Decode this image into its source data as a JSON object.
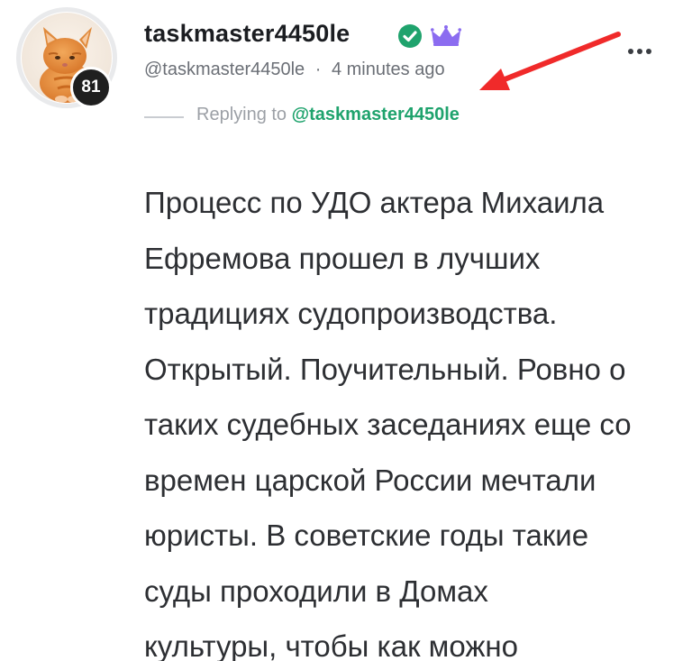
{
  "author": {
    "display_name": "taskmaster4450le",
    "handle": "@taskmaster4450le",
    "reputation": "81",
    "avatar_icon": "orange-kitten-avatar",
    "verified_icon": "verified-check-icon",
    "verified_color": "#1fa36d",
    "crown_icon": "crown-icon",
    "crown_color": "#8b6cf0"
  },
  "meta": {
    "separator": "·",
    "timestamp": "4 minutes ago"
  },
  "reply": {
    "prefix": "Replying to",
    "to_handle": "@taskmaster4450le"
  },
  "actions": {
    "more_icon": "more-horizontal-icon"
  },
  "annotation": {
    "arrow_color": "#f02a2a"
  },
  "body": {
    "lines": [
      "Процесс по УДО актера Михаила",
      "Ефремова прошел в лучших",
      "традициях судопроизводства.",
      "Открытый. Поучительный. Ровно о",
      "таких судебных заседаниях еще со",
      "времен царской России мечтали",
      "юристы. В советские годы такие",
      "суды проходили в Домах",
      "культуры, чтобы как можно"
    ]
  },
  "colors": {
    "accent_green": "#1fa36d",
    "text_dark": "#1b1d21",
    "text_muted": "#6b6f76"
  }
}
